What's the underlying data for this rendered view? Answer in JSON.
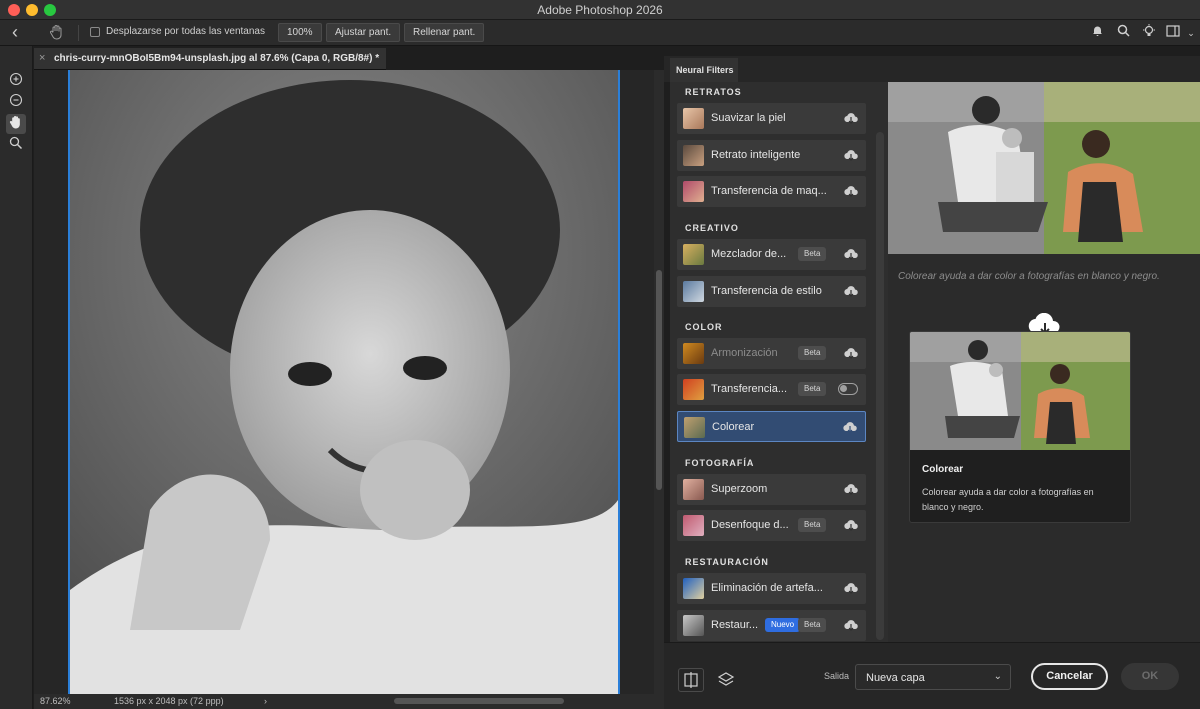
{
  "window": {
    "title": "Adobe Photoshop 2026"
  },
  "options_bar": {
    "scroll_all_windows_label": "Desplazarse por todas las ventanas",
    "zoom_100": "100%",
    "fit_screen": "Ajustar pant.",
    "fill_screen": "Rellenar pant."
  },
  "document": {
    "tab_label": "chris-curry-mnOBoI5Bm94-unsplash.jpg al 87.6% (Capa 0, RGB/8#) *",
    "close_glyph": "×"
  },
  "status": {
    "zoom": "87.62%",
    "dimensions": "1536 px x 2048 px (72 ppp)",
    "arrow": "›"
  },
  "neural_filters": {
    "tab_label": "Neural Filters",
    "sections": {
      "retratos": "RETRATOS",
      "creativo": "CREATIVO",
      "color": "COLOR",
      "fotografia": "FOTOGRAFÍA",
      "restauracion": "RESTAURACIÓN"
    },
    "items": {
      "suavizar": "Suavizar la piel",
      "retrato": "Retrato inteligente",
      "maquillaje": "Transferencia de maq...",
      "mezclador": "Mezclador de...",
      "estilo": "Transferencia de estilo",
      "armonizacion": "Armonización",
      "transferencia_color": "Transferencia...",
      "colorear": "Colorear",
      "superzoom": "Superzoom",
      "desenfoque": "Desenfoque d...",
      "artefactos": "Eliminación de artefa...",
      "restaurar": "Restaur..."
    },
    "badges": {
      "beta": "Beta",
      "nuevo": "Nuevo"
    },
    "preview_description": "Colorear ayuda a dar color a fotografías en blanco y negro.",
    "card": {
      "title": "Colorear",
      "text": "Colorear ayuda a dar color a fotografías en blanco y negro."
    },
    "output_label": "Salida",
    "output_value": "Nueva capa",
    "cancel": "Cancelar",
    "ok": "OK"
  }
}
